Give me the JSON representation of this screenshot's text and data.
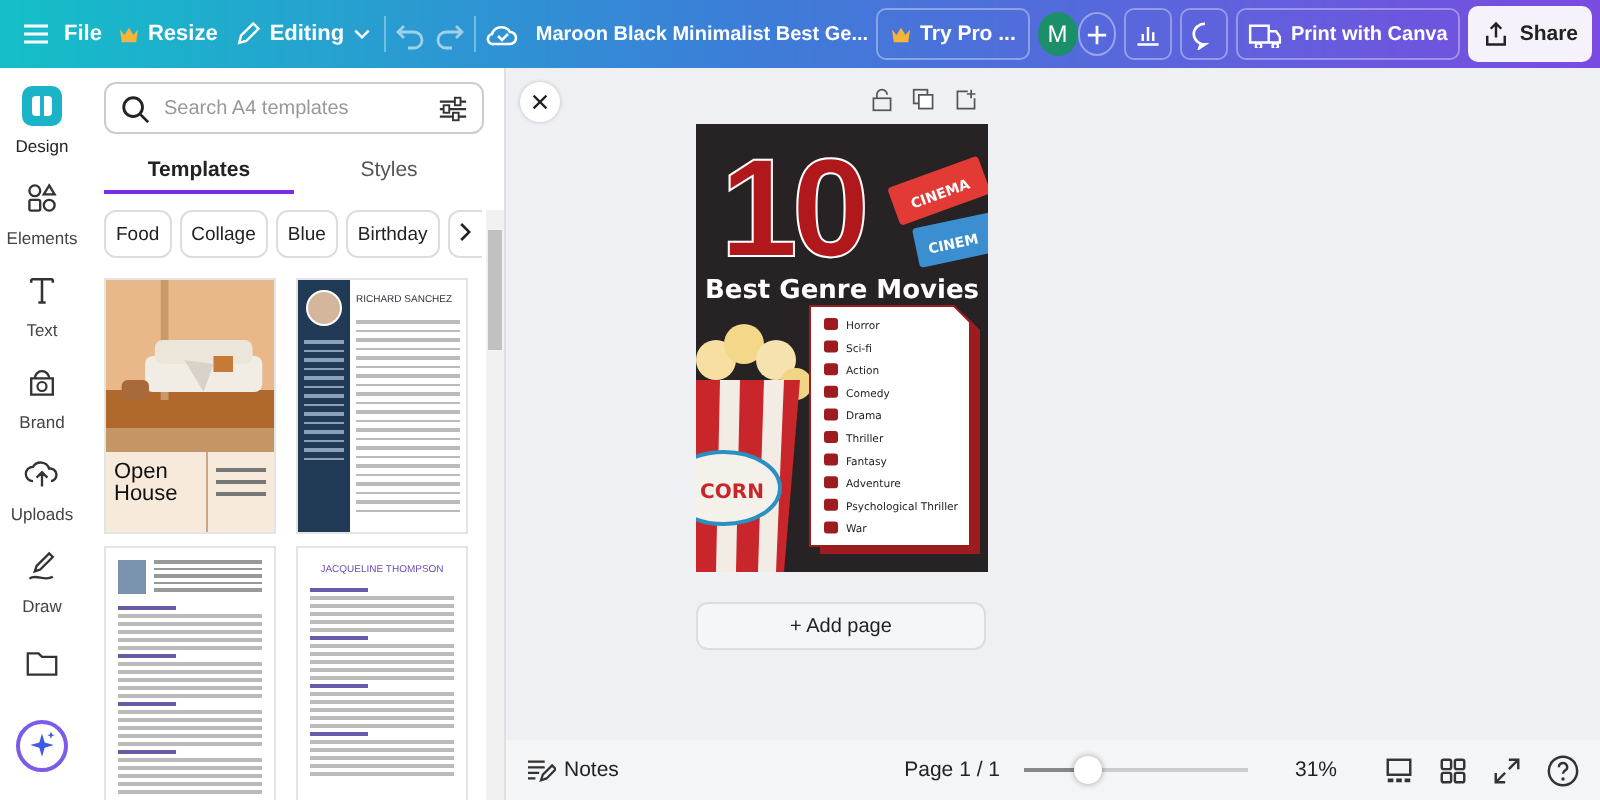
{
  "topbar": {
    "menu": "File",
    "resize": "Resize",
    "editing": "Editing",
    "title": "Maroon Black Minimalist Best Ge...",
    "try_pro": "Try Pro ...",
    "avatar": "M",
    "print": "Print with Canva",
    "share": "Share"
  },
  "rail": [
    {
      "label": "Design",
      "selected": true
    },
    {
      "label": "Elements",
      "selected": false
    },
    {
      "label": "Text",
      "selected": false
    },
    {
      "label": "Brand",
      "selected": false
    },
    {
      "label": "Uploads",
      "selected": false
    },
    {
      "label": "Draw",
      "selected": false
    }
  ],
  "panel": {
    "search_placeholder": "Search A4 templates",
    "tabs": [
      {
        "label": "Templates",
        "selected": true
      },
      {
        "label": "Styles",
        "selected": false
      }
    ],
    "chips": [
      "Food",
      "Collage",
      "Blue",
      "Birthday"
    ],
    "templates": [
      {
        "kind": "open-house",
        "title": "Open House"
      },
      {
        "kind": "resume-dark",
        "title": "RICHARD SANCHEZ"
      },
      {
        "kind": "resume-photo"
      },
      {
        "kind": "resume-plain",
        "title": "JACQUELINE THOMPSON"
      }
    ]
  },
  "poster": {
    "number": "10",
    "headline": "Best Genre Movies",
    "tickets": [
      "CINEMA",
      "CINEM"
    ],
    "popcorn_label": "CORN",
    "genres": [
      "Horror",
      "Sci-fi",
      "Action",
      "Comedy",
      "Drama",
      "Thriller",
      "Fantasy",
      "Adventure",
      "Psychological Thriller",
      "War"
    ]
  },
  "add_page": "+ Add page",
  "bottom": {
    "notes": "Notes",
    "page": "Page 1 / 1",
    "zoom": {
      "level": 0.29,
      "reading": "31%"
    }
  }
}
